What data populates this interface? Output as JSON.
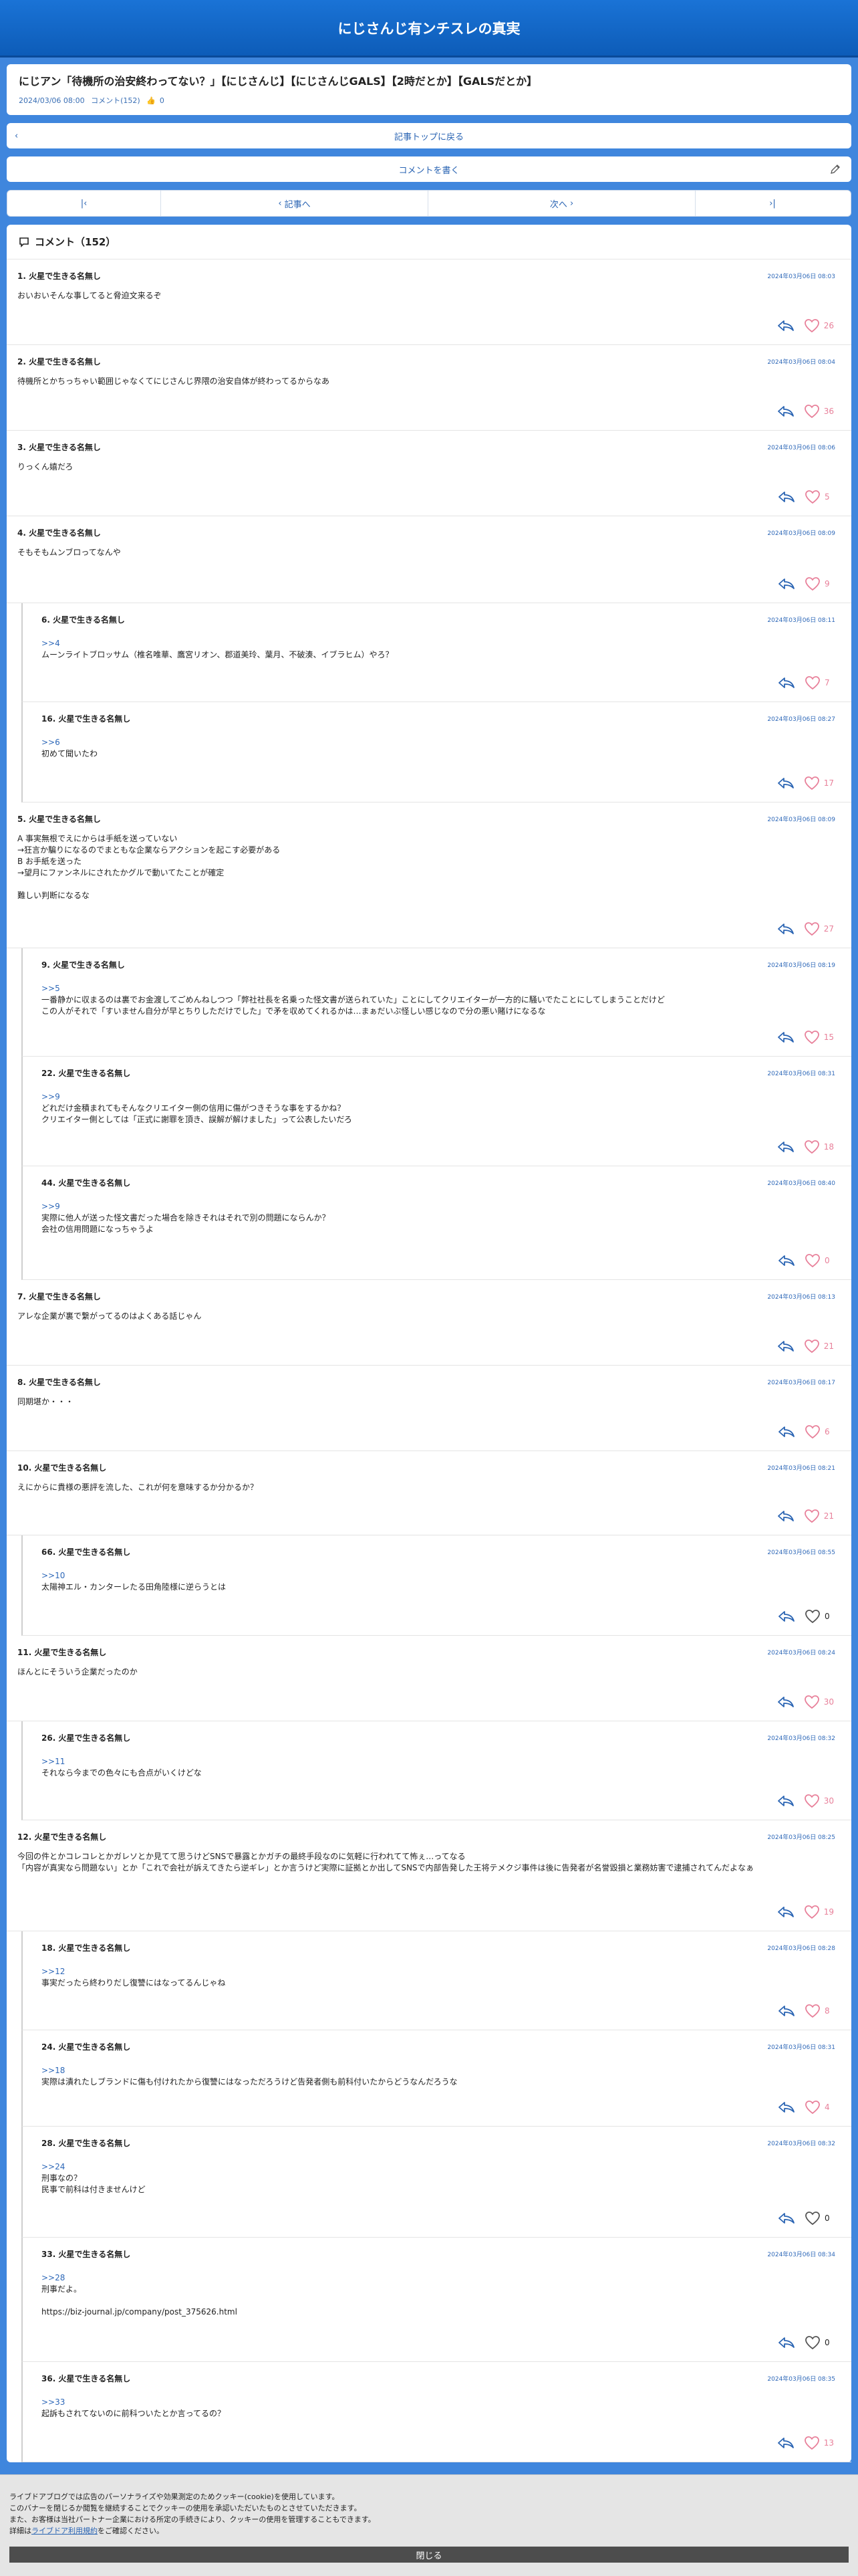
{
  "site": {
    "title": "にじさんじ有ンチスレの真実"
  },
  "article": {
    "title": "にじアン「待機所の治安終わってない？」【にじさんじ】【にじさんじGALS】【2時だとか】【GALSだとか】",
    "date": "2024/03/06 08:00",
    "comments_link": "コメント(152)",
    "likes": "0"
  },
  "nav": {
    "back_top": "記事トップに戻る",
    "write_comment": "コメントを書く",
    "prev": "記事へ",
    "next": "次へ"
  },
  "comments_header": "コメント（152）",
  "comments": [
    {
      "name": "1.  火星で生きる名無し",
      "date": "2024年03月06日 08:03",
      "anchor": "",
      "body": "おいおいそんな事してると脅迫文来るぞ",
      "likes": "26",
      "liked": true
    },
    {
      "name": "2.  火星で生きる名無し",
      "date": "2024年03月06日 08:04",
      "anchor": "",
      "body": "待機所とかちっちゃい範囲じゃなくてにじさんじ界隈の治安自体が終わってるからなあ",
      "likes": "36",
      "liked": true
    },
    {
      "name": "3.  火星で生きる名無し",
      "date": "2024年03月06日 08:06",
      "anchor": "",
      "body": "りっくん嬉だろ",
      "likes": "5",
      "liked": true
    },
    {
      "name": "4.  火星で生きる名無し",
      "date": "2024年03月06日 08:09",
      "anchor": "",
      "body": "そもそもムンブロってなんや",
      "likes": "9",
      "liked": true
    },
    {
      "name": "6.  火星で生きる名無し",
      "date": "2024年03月06日 08:11",
      "anchor": ">>4",
      "body": "ムーンライトブロッサム（椎名唯華、鷹宮リオン、郡道美玲、葉月、不破湊、イブラヒム）やろ？",
      "likes": "7",
      "liked": true
    },
    {
      "name": "16.  火星で生きる名無し",
      "date": "2024年03月06日 08:27",
      "anchor": ">>6",
      "body": "初めて聞いたわ",
      "likes": "17",
      "liked": true
    },
    {
      "name": "5.  火星で生きる名無し",
      "date": "2024年03月06日 08:09",
      "anchor": "",
      "body": "A 事実無根でえにからは手紙を送っていない\n→狂言か騙りになるのでまともな企業ならアクションを起こす必要がある\nB お手紙を送った\n→望月にファンネルにされたかグルで動いてたことが確定\n\n難しい判断になるな",
      "likes": "27",
      "liked": true
    },
    {
      "name": "9.  火星で生きる名無し",
      "date": "2024年03月06日 08:19",
      "anchor": ">>5",
      "body": "一番静かに収まるのは裏でお金渡してごめんねしつつ「弊社社長を名乗った怪文書が送られていた」ことにしてクリエイターが一方的に騒いでたことにしてしまうことだけど\nこの人がそれで「すいません自分が早とちりしただけでした」で矛を収めてくれるかは…まぁだいぶ怪しい感じなので分の悪い賭けになるな",
      "likes": "15",
      "liked": true
    },
    {
      "name": "22.  火星で生きる名無し",
      "date": "2024年03月06日 08:31",
      "anchor": ">>9",
      "body": "どれだけ金積まれてもそんなクリエイター側の信用に傷がつきそうな事をするかね？\nクリエイター側としては「正式に謝罪を頂き、誤解が解けました」って公表したいだろ",
      "likes": "18",
      "liked": true
    },
    {
      "name": "44.  火星で生きる名無し",
      "date": "2024年03月06日 08:40",
      "anchor": ">>9",
      "body": "実際に他人が送った怪文書だった場合を除きそれはそれで別の問題にならんか？\n会社の信用問題になっちゃうよ",
      "likes": "0",
      "liked": true
    },
    {
      "name": "7.  火星で生きる名無し",
      "date": "2024年03月06日 08:13",
      "anchor": "",
      "body": "アレな企業が裏で繋がってるのはよくある話じゃん",
      "likes": "21",
      "liked": true
    },
    {
      "name": "8.  火星で生きる名無し",
      "date": "2024年03月06日 08:17",
      "anchor": "",
      "body": "同期堪か・・・",
      "likes": "6",
      "liked": true
    },
    {
      "name": "10.  火星で生きる名無し",
      "date": "2024年03月06日 08:21",
      "anchor": "",
      "body": "えにからに貴様の悪評を流した、これが何を意味するか分かるか？",
      "likes": "21",
      "liked": true
    },
    {
      "name": "66.  火星で生きる名無し",
      "date": "2024年03月06日 08:55",
      "anchor": ">>10",
      "body": "太陽神エル・カンターレたる田角陸様に逆らうとは",
      "likes": "0",
      "liked": false
    },
    {
      "name": "11.  火星で生きる名無し",
      "date": "2024年03月06日 08:24",
      "anchor": "",
      "body": "ほんとにそういう企業だったのか",
      "likes": "30",
      "liked": true
    },
    {
      "name": "26.  火星で生きる名無し",
      "date": "2024年03月06日 08:32",
      "anchor": ">>11",
      "body": "それなら今までの色々にも合点がいくけどな",
      "likes": "30",
      "liked": true
    },
    {
      "name": "12.  火星で生きる名無し",
      "date": "2024年03月06日 08:25",
      "anchor": "",
      "body": "今回の件とかコレコレとかガレソとか見てて思うけどSNSで暴露とかガチの最終手段なのに気軽に行われてて怖ぇ…ってなる\n「内容が真実なら問題ない」とか「これで会社が訴えてきたら逆ギレ」とか言うけど実際に証拠とか出してSNSで内部告発した王将テメクジ事件は後に告発者が名誉毀損と業務妨害で逮捕されてんだよなぁ",
      "likes": "19",
      "liked": true
    },
    {
      "name": "18.  火星で生きる名無し",
      "date": "2024年03月06日 08:28",
      "anchor": ">>12",
      "body": "事実だったら終わりだし復讐にはなってるんじゃね",
      "likes": "8",
      "liked": true
    },
    {
      "name": "24.  火星で生きる名無し",
      "date": "2024年03月06日 08:31",
      "anchor": ">>18",
      "body": "実際は潰れたしブランドに傷も付けれたから復讐にはなっただろうけど告発者側も前科付いたからどうなんだろうな",
      "likes": "4",
      "liked": true
    },
    {
      "name": "28.  火星で生きる名無し",
      "date": "2024年03月06日 08:32",
      "anchor": ">>24",
      "body": "刑事なの？\n民事で前科は付きませんけど",
      "likes": "0",
      "liked": false
    },
    {
      "name": "33.  火星で生きる名無し",
      "date": "2024年03月06日 08:34",
      "anchor": ">>28",
      "body": "刑事だよ。\n\nhttps://biz-journal.jp/company/post_375626.html",
      "likes": "0",
      "liked": false
    },
    {
      "name": "36.  火星で生きる名無し",
      "date": "2024年03月06日 08:35",
      "anchor": ">>33",
      "body": "起訴もされてないのに前科ついたとか言ってるの？",
      "likes": "13",
      "liked": true
    }
  ],
  "cookie": {
    "line1": "ライブドアブログでは広告のパーソナライズや効果測定のためクッキー(cookie)を使用しています。",
    "line2": "このバナーを閉じるか閲覧を継続することでクッキーの使用を承認いただいたものとさせていただきます。",
    "line3": "また、お客様は当社パートナー企業における所定の手続きにより、クッキーの使用を管理することもできます。",
    "line4_pre": "詳細は",
    "line4_link": "ライブドア利用規約",
    "line4_post": "をご確認ください。",
    "close": "閉じる"
  },
  "colors": {
    "header": "#1a73d6",
    "background": "#3f86dd",
    "link": "#2a64b3",
    "heart": "#e8809a"
  },
  "icons": [
    "chevron-left-icon",
    "pencil-icon",
    "first-page-icon",
    "last-page-icon",
    "comment-icon",
    "reply-icon",
    "heart-icon"
  ]
}
